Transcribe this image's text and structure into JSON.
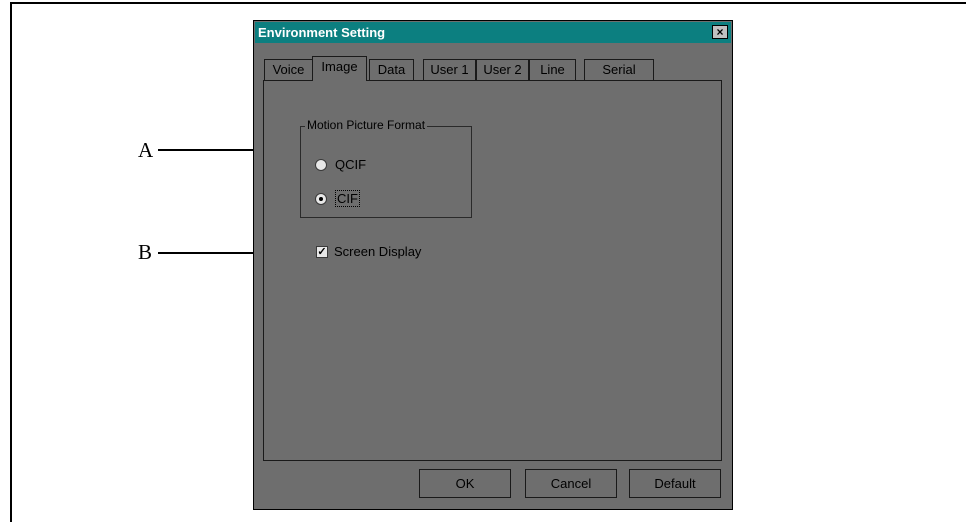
{
  "dialog": {
    "title": "Environment Setting",
    "close_glyph": "×",
    "tabs": [
      {
        "label": "Voice"
      },
      {
        "label": "Image"
      },
      {
        "label": "Data"
      },
      {
        "label": "User 1"
      },
      {
        "label": "User 2"
      },
      {
        "label": "Line"
      },
      {
        "label": "Serial"
      }
    ],
    "active_tab": "Image",
    "motion_picture_format": {
      "legend": "Motion Picture Format",
      "options": [
        {
          "label": "QCIF",
          "checked": false
        },
        {
          "label": "CIF",
          "checked": true
        }
      ]
    },
    "screen_display": {
      "label": "Screen Display",
      "checked": true,
      "check_glyph": "✓"
    },
    "buttons": {
      "ok": "OK",
      "cancel": "Cancel",
      "default": "Default"
    }
  },
  "callouts": {
    "a": "A",
    "b": "B"
  },
  "colors": {
    "titlebar": "#0c7f80",
    "dialog_bg": "#6e6e6e"
  }
}
